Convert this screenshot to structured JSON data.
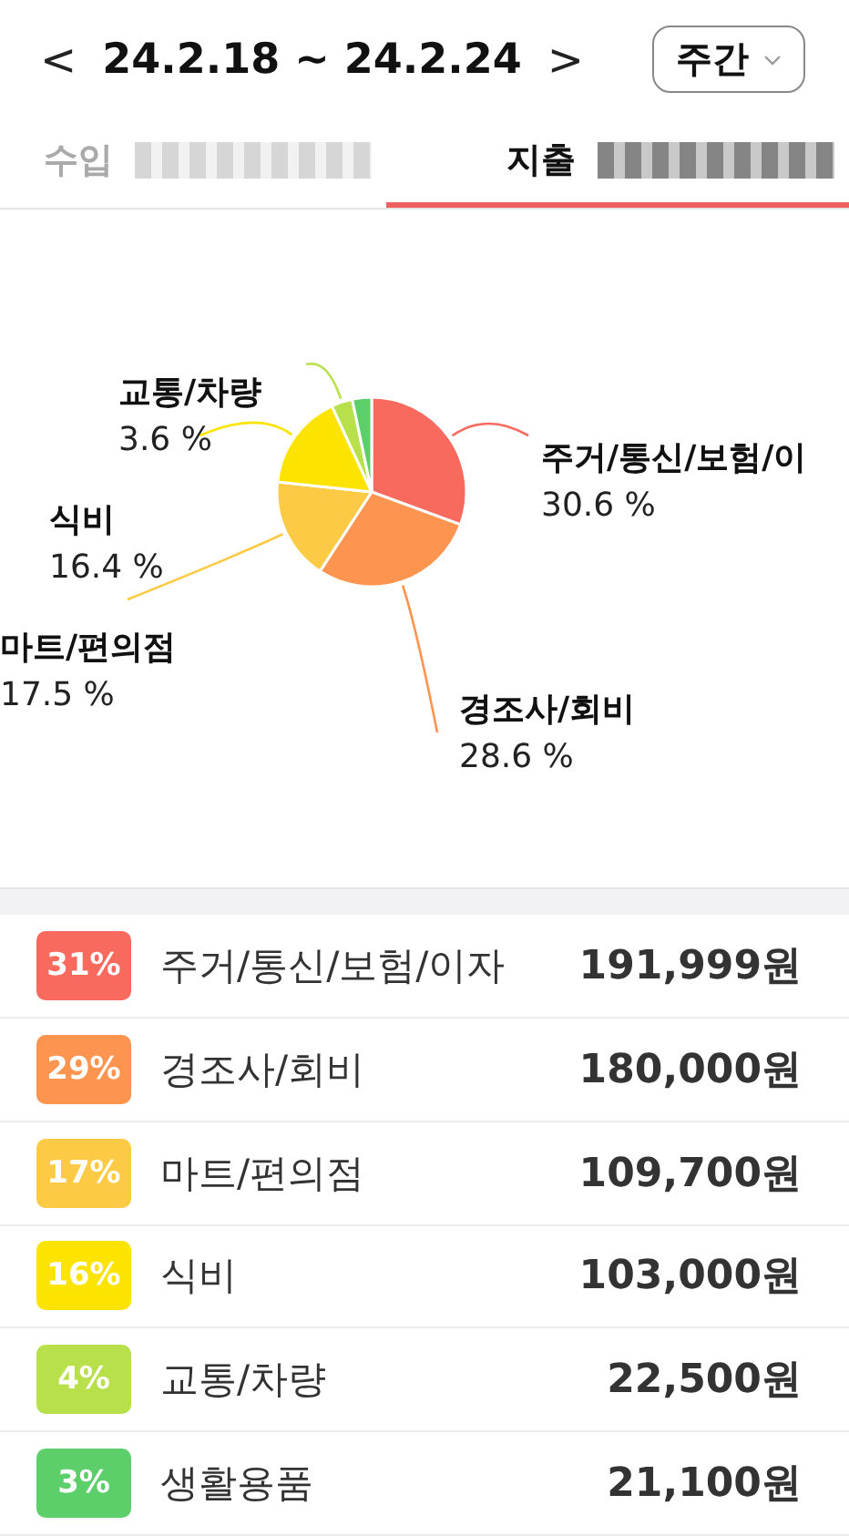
{
  "header": {
    "prev": "<",
    "range": "24.2.18 ~ 24.2.24",
    "next": ">",
    "period": "주간"
  },
  "tabs": [
    {
      "label": "수입",
      "selected": false
    },
    {
      "label": "지출",
      "selected": true
    }
  ],
  "chart_data": {
    "type": "pie",
    "values": [
      30.6,
      28.6,
      17.5,
      16.4,
      3.6,
      3.3
    ],
    "colors": [
      "#f86a5e",
      "#fd9550",
      "#fdca45",
      "#fde300",
      "#b8e04a",
      "#5ccf6b"
    ]
  },
  "callouts": [
    {
      "name": "교통/차량",
      "percent": "3.6 %"
    },
    {
      "name": "주거/통신/보험/이",
      "percent": "30.6 %"
    },
    {
      "name": "식비",
      "percent": "16.4 %"
    },
    {
      "name": "마트/편의점",
      "percent": "17.5 %"
    },
    {
      "name": "경조사/회비",
      "percent": "28.6 %"
    }
  ],
  "items": [
    {
      "badge": "31%",
      "name": "주거/통신/보험/이자",
      "amount": "191,999원",
      "color": "#f86a5e"
    },
    {
      "badge": "29%",
      "name": "경조사/회비",
      "amount": "180,000원",
      "color": "#fd9550"
    },
    {
      "badge": "17%",
      "name": "마트/편의점",
      "amount": "109,700원",
      "color": "#fdca45"
    },
    {
      "badge": "16%",
      "name": "식비",
      "amount": "103,000원",
      "color": "#fde300"
    },
    {
      "badge": "4%",
      "name": "교통/차량",
      "amount": "22,500원",
      "color": "#b8e04a"
    },
    {
      "badge": "3%",
      "name": "생활용품",
      "amount": "21,100원",
      "color": "#5ccf6b"
    }
  ]
}
